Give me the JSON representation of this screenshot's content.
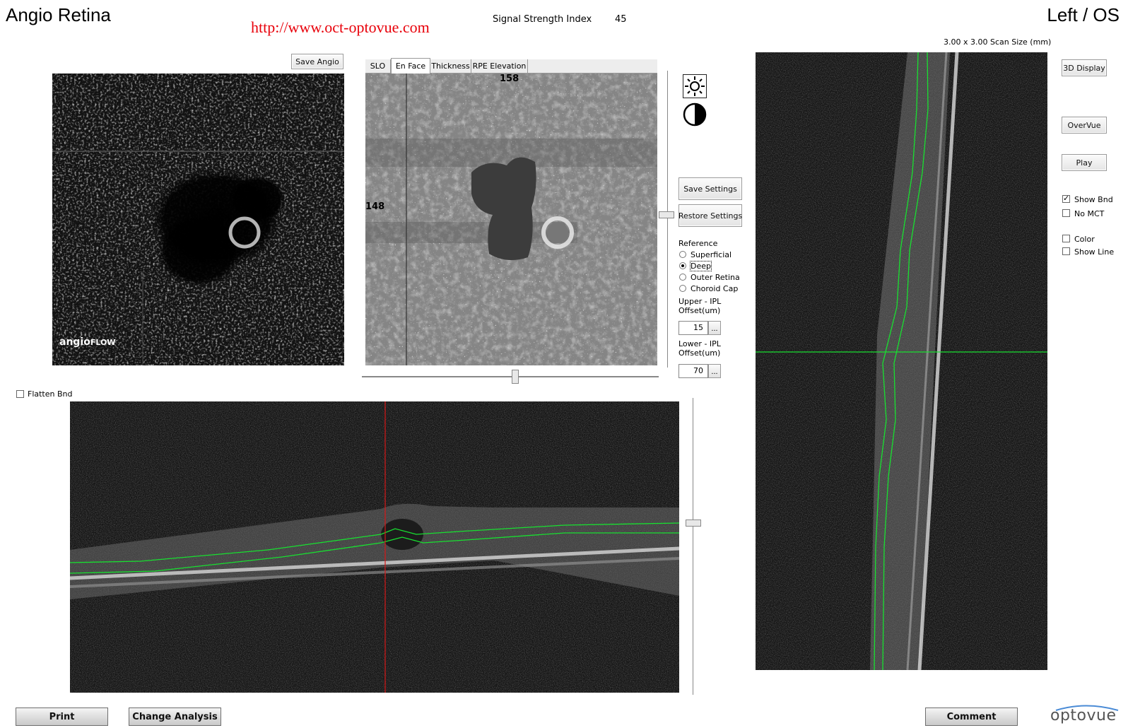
{
  "header": {
    "title": "Angio Retina",
    "url": "http://www.oct-optovue.com",
    "signal_label": "Signal Strength Index",
    "signal_value": "45",
    "eye": "Left / OS",
    "scan_size": "3.00 x 3.00 Scan Size (mm)"
  },
  "angio_panel": {
    "save_label": "Save Angio",
    "watermark_a": "angio",
    "watermark_b": "FLOW"
  },
  "enface_panel": {
    "tabs": [
      "SLO",
      "En Face",
      "Thickness",
      "RPE Elevation"
    ],
    "active_tab": "En Face",
    "top_marker": "158",
    "left_marker": "148"
  },
  "controls": {
    "brightness_icon": "sun-icon",
    "contrast_icon": "contrast-icon",
    "save_settings": "Save Settings",
    "restore_settings": "Restore Settings",
    "reference_label": "Reference",
    "reference_options": [
      "Superficial",
      "Deep",
      "Outer Retina",
      "Choroid Cap"
    ],
    "reference_selected": "Deep",
    "upper_label_1": "Upper - IPL",
    "upper_label_2": "Offset(um)",
    "upper_value": "15",
    "lower_label_1": "Lower - IPL",
    "lower_label_2": "Offset(um)",
    "lower_value": "70",
    "ellipsis": "..."
  },
  "bscan": {
    "flatten_label": "Flatten Bnd",
    "flatten_checked": false
  },
  "right_panel": {
    "display_3d": "3D Display",
    "overvue": "OverVue",
    "play": "Play",
    "show_bnd": "Show Bnd",
    "show_bnd_checked": true,
    "no_mct": "No MCT",
    "no_mct_checked": false,
    "color": "Color",
    "color_checked": false,
    "show_line": "Show Line",
    "show_line_checked": false
  },
  "footer": {
    "print": "Print",
    "change_analysis": "Change Analysis",
    "comment": "Comment",
    "logo": "optovue"
  },
  "colors": {
    "url_red": "#e8000a",
    "boundary_green": "#18e030",
    "cursor_red": "#d81818"
  }
}
